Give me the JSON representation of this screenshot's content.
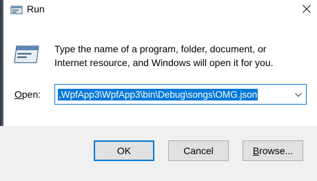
{
  "window": {
    "title": "Run",
    "close_icon": "close-icon",
    "title_icon": "run-icon"
  },
  "message": {
    "line1": "Type the name of a program, folder, document, or",
    "line2": "Internet resource, and Windows will open it for you."
  },
  "open": {
    "label_prefix": "",
    "label_mnemonic": "O",
    "label_suffix": "pen:",
    "value": ",WpfApp3\\WpfApp3\\bin\\Debug\\songs\\OMG.json",
    "dropdown_icon": "chevron-down-icon"
  },
  "buttons": {
    "ok_label": "OK",
    "cancel_label": "Cancel",
    "browse_prefix": "",
    "browse_mnemonic": "B",
    "browse_suffix": "rowse..."
  },
  "colors": {
    "accent": "#0078d7",
    "button_bar": "#f0f0f0",
    "button_face": "#e1e1e1"
  }
}
